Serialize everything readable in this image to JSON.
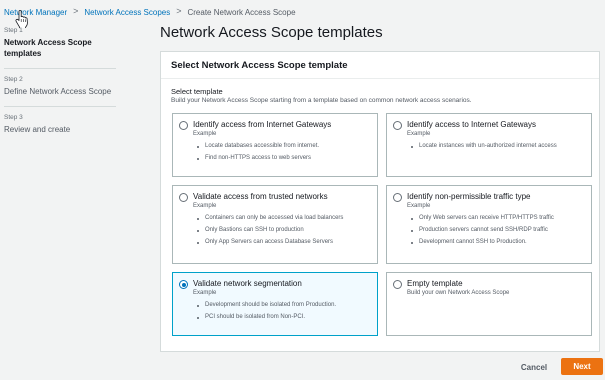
{
  "breadcrumb": {
    "items": [
      {
        "label": "Network Manager"
      },
      {
        "label": "Network Access Scopes"
      },
      {
        "label": "Create Network Access Scope"
      }
    ],
    "separator": ">"
  },
  "steps": [
    {
      "label": "Step 1",
      "title": "Network Access Scope templates",
      "active": true
    },
    {
      "label": "Step 2",
      "title": "Define Network Access Scope",
      "active": false
    },
    {
      "label": "Step 3",
      "title": "Review and create",
      "active": false
    }
  ],
  "page": {
    "title": "Network Access Scope templates"
  },
  "panel": {
    "header": "Select Network Access Scope template",
    "field_label": "Select template",
    "field_description": "Build your Network Access Scope starting from a template based on common network access scenarios."
  },
  "templates": [
    {
      "title": "Identify access from Internet Gateways",
      "subtitle": "Example",
      "items": [
        "Locate databases accessible from internet.",
        "Find non-HTTPS access to web servers"
      ],
      "selected": false
    },
    {
      "title": "Identify access to Internet Gateways",
      "subtitle": "Example",
      "items": [
        "Locate instances with un-authorized internet access"
      ],
      "selected": false
    },
    {
      "title": "Validate access from trusted networks",
      "subtitle": "Example",
      "items": [
        "Containers can only be accessed via load balancers",
        "Only Bastions can SSH to production",
        "Only App Servers can access Database Servers"
      ],
      "selected": false
    },
    {
      "title": "Identify non-permissible traffic type",
      "subtitle": "Example",
      "items": [
        "Only Web servers can receive HTTP/HTTPS traffic",
        "Production servers cannot send SSH/RDP traffic",
        "Development cannot SSH to Production."
      ],
      "selected": false
    },
    {
      "title": "Validate network segmentation",
      "subtitle": "Example",
      "items": [
        "Development should be isolated from Production.",
        "PCI should be isolated from Non-PCI."
      ],
      "selected": true
    },
    {
      "title": "Empty template",
      "subtitle": "Build your own Network Access Scope",
      "items": [],
      "selected": false
    }
  ],
  "footer": {
    "cancel_label": "Cancel",
    "next_label": "Next"
  },
  "colors": {
    "link": "#0073bb",
    "selected_border": "#00a1c9",
    "selected_background": "#f1faff",
    "primary_button": "#ec7211"
  },
  "icons": {
    "cursor": "hand-pointer-icon",
    "separator": "chevron-right-icon"
  }
}
